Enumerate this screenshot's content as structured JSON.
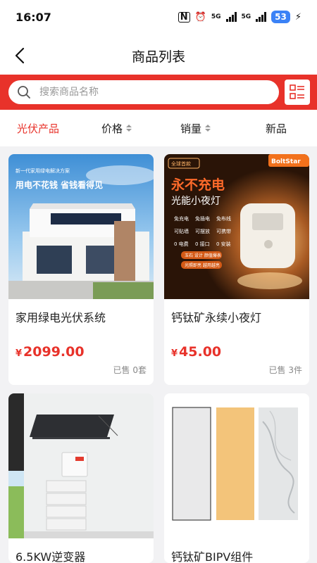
{
  "status_bar": {
    "time": "16:07",
    "battery": "53",
    "network_1": "5G",
    "network_2": "5G"
  },
  "nav": {
    "title": "商品列表"
  },
  "search": {
    "placeholder": "搜索商品名称",
    "value": ""
  },
  "filters": [
    {
      "label": "光伏产品",
      "active": true
    },
    {
      "label": "价格"
    },
    {
      "label": "销量"
    },
    {
      "label": "新品"
    }
  ],
  "products": [
    {
      "title": "家用绿电光伏系统",
      "currency": "¥",
      "price": "2099.00",
      "sold": "已售 0套",
      "banner_small": "新一代家用绿电解决方案",
      "banner_main": "用电不花钱 省钱看得见"
    },
    {
      "title": "钙钛矿永续小夜灯",
      "currency": "¥",
      "price": "45.00",
      "sold": "已售 3件",
      "badge": "全球首款",
      "brand": "BoltStar",
      "headline": "永不充电",
      "subheadline": "光能小夜灯",
      "features": [
        "免充电",
        "免插电",
        "免布线",
        "可贴墙",
        "可摆放",
        "可携带",
        "0 电费",
        "0 接口",
        "0 安装"
      ],
      "tag1": "玉石 设计 颜值爆表",
      "tag2": "光照即亮 越用越亮"
    },
    {
      "title": "6.5KW逆变器"
    },
    {
      "title": "钙钛矿BIPV组件"
    }
  ]
}
